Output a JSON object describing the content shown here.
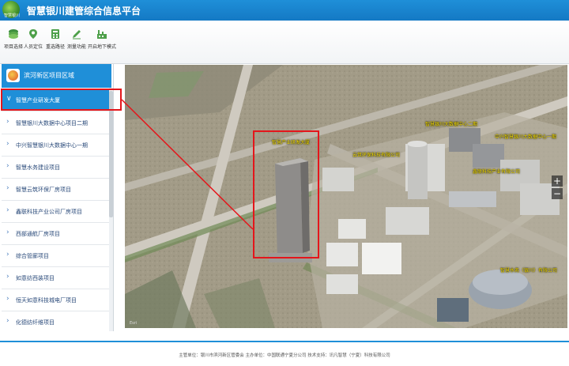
{
  "header": {
    "logo_text": "智慧银川",
    "title": "智慧银川建管综合信息平台",
    "bg_color": "#1f8fd8"
  },
  "toolbar": [
    {
      "label": "项目选择",
      "icon": "layers-icon"
    },
    {
      "label": "人员定位",
      "icon": "location-pin-icon"
    },
    {
      "label": "重选路径",
      "icon": "calculator-icon"
    },
    {
      "label": "测量功能",
      "icon": "pencil-icon"
    },
    {
      "label": "开启地下模式",
      "icon": "factory-icon"
    }
  ],
  "sidebar": {
    "title": "滨河新区项目区域",
    "items": [
      {
        "label": "智慧产业研发大厦",
        "active": true
      },
      {
        "label": "智慧银川大数据中心项目二期"
      },
      {
        "label": "中兴智慧银川大数据中心一期"
      },
      {
        "label": "智慧水务建设项目"
      },
      {
        "label": "智慧云筑环保厂房项目"
      },
      {
        "label": "鑫联科技产业公司厂房项目"
      },
      {
        "label": "西部通航厂房项目"
      },
      {
        "label": "综合管廊项目"
      },
      {
        "label": "如意纺西装项目"
      },
      {
        "label": "恒天如意科技城电厂项目"
      },
      {
        "label": "化德纺纤维项目"
      }
    ]
  },
  "map": {
    "labels": [
      {
        "text": "智慧产业研发大厦"
      },
      {
        "text": "云筑环保科技有限公司"
      },
      {
        "text": "智慧银川大数据中心二期"
      },
      {
        "text": "中兴智慧银川大数据中心一期"
      },
      {
        "text": "鑫联科技产业有限公司"
      },
      {
        "text": "智慧水务（银川）有限公司"
      }
    ],
    "zoom_in": "+",
    "zoom_out": "−",
    "attribution": "Esri"
  },
  "footer": {
    "text": "主管单位：银川市滨河新区管委会  主办单位：中国联通宁夏分公司  技术支持：讯凡智慧（宁夏）科技有限公司"
  }
}
